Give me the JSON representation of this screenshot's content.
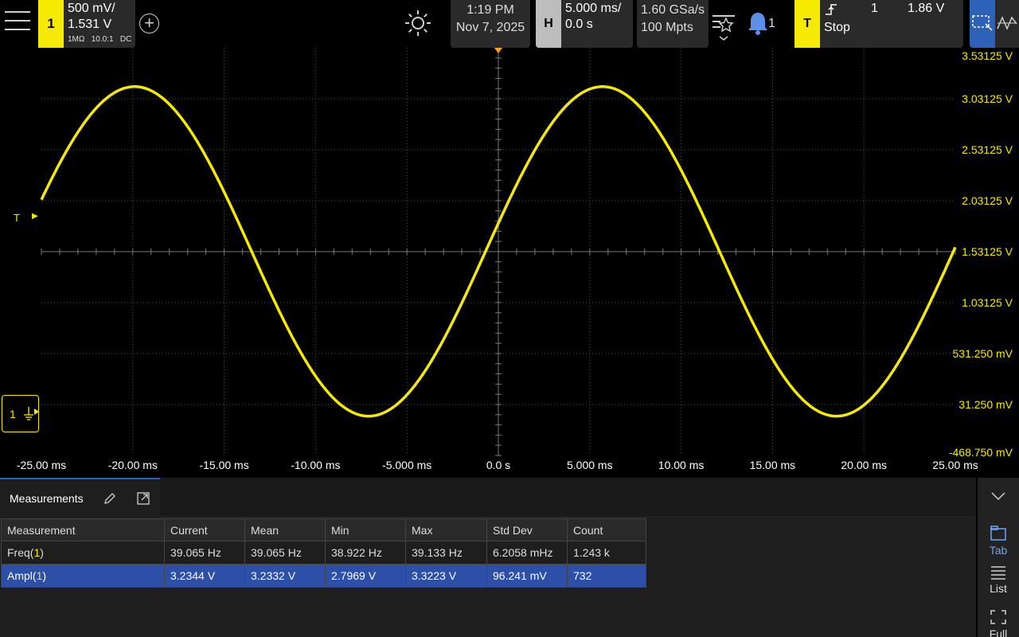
{
  "channel": {
    "number": "1",
    "scale": "500 mV/",
    "offset": "1.531 V",
    "impedance": "1MΩ",
    "probe": "10.0:1",
    "coupling": "DC",
    "ground_label": "1"
  },
  "datetime": {
    "time": "1:19 PM",
    "date": "Nov 7, 2025"
  },
  "horizontal": {
    "tag": "H",
    "scale": "5.000 ms/",
    "position": "0.0 s"
  },
  "acquisition": {
    "sample_rate": "1.60 GSa/s",
    "memory": "100 Mpts"
  },
  "notifications": {
    "count": "1"
  },
  "trigger": {
    "tag": "T",
    "source": "1",
    "level": "1.86 V",
    "mode": "Stop",
    "marker": "T"
  },
  "colors": {
    "channel1": "#f5ea00",
    "accent": "#2e62b8",
    "selected_row": "#2e4fa8"
  },
  "y_axis_labels": [
    "3.53125 V",
    "3.03125 V",
    "2.53125 V",
    "2.03125 V",
    "1.53125 V",
    "1.03125 V",
    "531.250 mV",
    "31.250 mV",
    "-468.750 mV"
  ],
  "x_axis_labels": [
    "-25.00 ms",
    "-20.00 ms",
    "-15.00 ms",
    "-10.00 ms",
    "-5.000 ms",
    "0.0 s",
    "5.000 ms",
    "10.00 ms",
    "15.00 ms",
    "20.00 ms",
    "25.00 ms"
  ],
  "measurements": {
    "tab_title": "Measurements",
    "headers": [
      "Measurement",
      "Current",
      "Mean",
      "Min",
      "Max",
      "Std Dev",
      "Count"
    ],
    "rows": [
      {
        "name": "Freq(",
        "channel": "1",
        "close": ")",
        "current": "39.065 Hz",
        "mean": "39.065 Hz",
        "min": "38.922 Hz",
        "max": "39.133 Hz",
        "std_dev": "6.2058 mHz",
        "count": "1.243 k"
      },
      {
        "name": "Ampl(",
        "channel": "1",
        "close": ")",
        "current": "3.2344 V",
        "mean": "3.2332 V",
        "min": "2.7969 V",
        "max": "3.3223 V",
        "std_dev": "96.241 mV",
        "count": "732"
      }
    ]
  },
  "side_panel": {
    "tab": "Tab",
    "list": "List",
    "full": "Full"
  },
  "chart_data": {
    "type": "line",
    "title": "",
    "xlabel": "",
    "ylabel": "",
    "x_unit": "ms",
    "y_unit": "V",
    "xlim": [
      -25,
      25
    ],
    "ylim": [
      -0.46875,
      3.53125
    ],
    "grid": true,
    "series": [
      {
        "frequency_hz": 39.065,
        "amplitude_v": 3.2344,
        "center_v": 1.53125,
        "peak_v": 3.15,
        "trough_v": -0.083,
        "first_peak_ms": -19.9,
        "color": "#f5ea00"
      }
    ]
  }
}
